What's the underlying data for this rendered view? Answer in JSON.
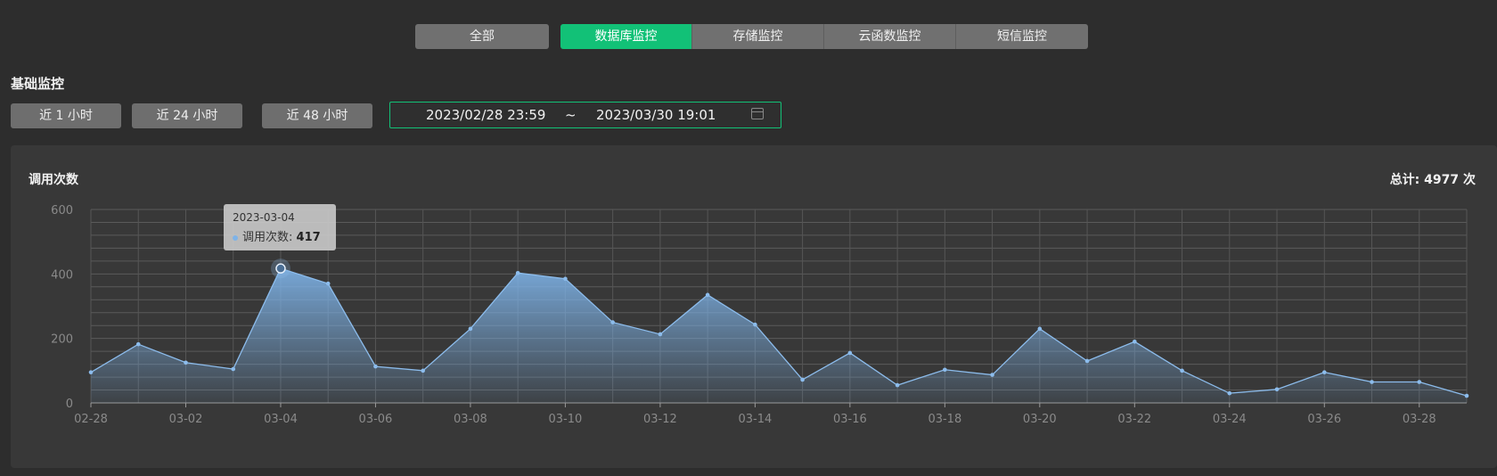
{
  "tabs": {
    "all": "全部",
    "items": [
      {
        "label": "数据库监控",
        "active": true
      },
      {
        "label": "存储监控"
      },
      {
        "label": "云函数监控"
      },
      {
        "label": "短信监控"
      }
    ]
  },
  "section_title": "基础监控",
  "range_buttons": [
    "近 1 小时",
    "近 24 小时",
    "近 48 小时"
  ],
  "date_range": {
    "start": "2023/02/28 23:59",
    "separator": "~",
    "end": "2023/03/30 19:01"
  },
  "accent_color": "#12c177",
  "chart_data": {
    "type": "area",
    "title": "调用次数",
    "total_label": "总计: 4977 次",
    "series": [
      {
        "name": "调用次数",
        "color": "#7eb3e8",
        "values": [
          95,
          182,
          125,
          105,
          417,
          370,
          113,
          100,
          230,
          403,
          385,
          250,
          213,
          335,
          243,
          72,
          155,
          55,
          103,
          87,
          230,
          130,
          190,
          100,
          30,
          42,
          95,
          65,
          65,
          22
        ]
      }
    ],
    "x": [
      "02-28",
      "03-01",
      "03-02",
      "03-03",
      "03-04",
      "03-05",
      "03-06",
      "03-07",
      "03-08",
      "03-09",
      "03-10",
      "03-11",
      "03-12",
      "03-13",
      "03-14",
      "03-15",
      "03-16",
      "03-17",
      "03-18",
      "03-19",
      "03-20",
      "03-21",
      "03-22",
      "03-23",
      "03-24",
      "03-25",
      "03-26",
      "03-27",
      "03-28",
      "03-29"
    ],
    "xtick_labels": [
      "02-28",
      "03-02",
      "03-04",
      "03-06",
      "03-08",
      "03-10",
      "03-12",
      "03-14",
      "03-16",
      "03-18",
      "03-20",
      "03-22",
      "03-24",
      "03-26",
      "03-28"
    ],
    "yticks": [
      0,
      200,
      400,
      600
    ],
    "ylim": [
      0,
      600
    ],
    "tooltip": {
      "date": "2023-03-04",
      "label": "调用次数:",
      "value": "417",
      "index": 4
    }
  }
}
